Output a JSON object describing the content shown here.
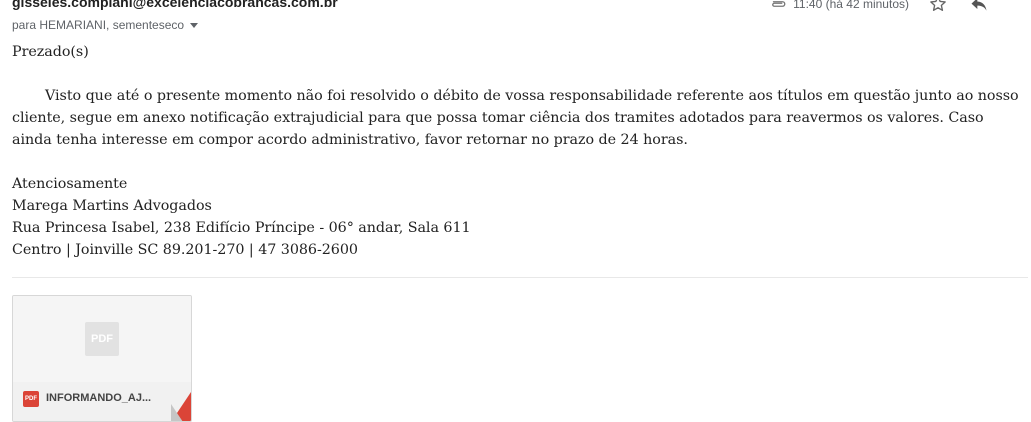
{
  "header": {
    "sender_email": "gisseles.compiani@excelenciacobrancas.com.br",
    "recipients": "para HEMARIANI, sementeseco",
    "time": "11:40 (há 42 minutos)",
    "icons": [
      "paperclip-icon",
      "star-icon",
      "reply-icon",
      "expand-caret-icon"
    ]
  },
  "body": {
    "greeting": "Prezado(s)",
    "paragraph": "Visto que até o presente momento não foi resolvido o débito de vossa responsabilidade referente aos títulos em questão junto ao nosso cliente, segue em anexo notificação extrajudicial para que possa tomar ciência dos tramites adotados para reavermos os valores. Caso ainda tenha interesse em compor acordo administrativo, favor retornar no prazo de 24 horas.",
    "signature": {
      "closing": "Atenciosamente",
      "company": "Marega Martins Advogados",
      "address_line1": "Rua Princesa Isabel, 238 Edifício Príncipe - 06° andar, Sala 611",
      "address_line2": "Centro | Joinville SC 89.201-270 |  47 3086-2600"
    }
  },
  "attachment": {
    "preview_label": "PDF",
    "type_label": "PDF",
    "file_name": "INFORMANDO_AJ...",
    "colors": {
      "pdf_red": "#db4437",
      "preview_bg": "#f5f5f5",
      "preview_icon": "#e2e2e2"
    }
  }
}
